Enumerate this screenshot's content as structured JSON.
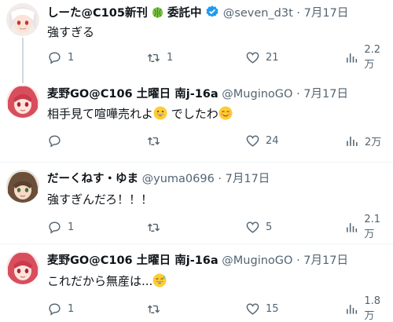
{
  "tweets": [
    {
      "name": "しーた@C105新刊",
      "name_suffix": "委託中",
      "handle": "@seven_d3t",
      "dot": "·",
      "date": "7月17日",
      "text": "強すぎる",
      "reply_count": "1",
      "retweet_count": "1",
      "like_count": "21",
      "views": "2.2万"
    },
    {
      "name": "麦野GO@C106 土曜日 南j-16a",
      "handle": "@MuginoGO",
      "dot": "·",
      "date": "7月17日",
      "text_a": "相手見て喧嘩売れよ",
      "text_b": "でしたわ",
      "reply_count": "",
      "retweet_count": "",
      "like_count": "24",
      "views": "2万"
    },
    {
      "name": "だーくねす・ゆま",
      "handle": "@yuma0696",
      "dot": "·",
      "date": "7月17日",
      "text": "強すぎんだろ！！！",
      "reply_count": "1",
      "retweet_count": "",
      "like_count": "5",
      "views": "2.1万"
    },
    {
      "name": "麦野GO@C106 土曜日 南j-16a",
      "handle": "@MuginoGO",
      "dot": "·",
      "date": "7月17日",
      "text": "これだから無産は...",
      "reply_count": "1",
      "retweet_count": "",
      "like_count": "15",
      "views": "1.8万"
    }
  ],
  "colors": {
    "text": "#0f1419",
    "secondary": "#536471",
    "verified": "#1d9bf0",
    "thread_line": "#cfd9de"
  }
}
